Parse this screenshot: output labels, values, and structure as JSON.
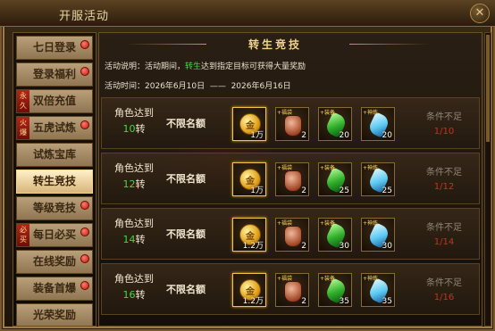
{
  "window": {
    "title": "开服活动",
    "close_glyph": "✕"
  },
  "sidebar": {
    "items": [
      {
        "label": "七日登录",
        "badge": true,
        "tag": "",
        "active": false
      },
      {
        "label": "登录福利",
        "badge": true,
        "tag": "",
        "active": false
      },
      {
        "label": "双倍充值",
        "badge": false,
        "tag": "永久",
        "active": false
      },
      {
        "label": "五虎试炼",
        "badge": true,
        "tag": "火爆",
        "active": false
      },
      {
        "label": "试炼宝库",
        "badge": false,
        "tag": "",
        "active": false
      },
      {
        "label": "转生竞技",
        "badge": false,
        "tag": "",
        "active": true
      },
      {
        "label": "等级竞技",
        "badge": true,
        "tag": "",
        "active": false
      },
      {
        "label": "每日必买",
        "badge": true,
        "tag": "必买",
        "active": false
      },
      {
        "label": "在线奖励",
        "badge": true,
        "tag": "",
        "active": false
      },
      {
        "label": "装备首爆",
        "badge": true,
        "tag": "",
        "active": false
      },
      {
        "label": "光荣奖励",
        "badge": false,
        "tag": "",
        "active": false
      }
    ]
  },
  "panel": {
    "banner": "转生竞技",
    "desc_prefix": "活动说明：活动期间，",
    "desc_highlight": "转生",
    "desc_suffix": "达到指定目标可获得大量奖励",
    "time_label": "活动时间：",
    "time_start": "2026年6月10日",
    "time_sep": "——",
    "time_end": "2026年6月16日"
  },
  "rows": [
    {
      "req_line1": "角色达到",
      "req_level": "10",
      "req_unit": "转",
      "quota": "不限名额",
      "rewards": [
        {
          "icon": "gold-coin-icon",
          "count": "1万",
          "ribbon": ""
        },
        {
          "icon": "lucky-bag-icon",
          "count": "2",
          "ribbon": "+福袋"
        },
        {
          "icon": "green-gem-icon",
          "count": "20",
          "ribbon": "+装备"
        },
        {
          "icon": "blue-crystal-icon",
          "count": "20",
          "ribbon": "+神炼"
        }
      ],
      "status": "条件不足",
      "progress": "1/10"
    },
    {
      "req_line1": "角色达到",
      "req_level": "12",
      "req_unit": "转",
      "quota": "不限名额",
      "rewards": [
        {
          "icon": "gold-coin-icon",
          "count": "1万",
          "ribbon": ""
        },
        {
          "icon": "lucky-bag-icon",
          "count": "2",
          "ribbon": "+福袋"
        },
        {
          "icon": "green-gem-icon",
          "count": "25",
          "ribbon": "+装备"
        },
        {
          "icon": "blue-crystal-icon",
          "count": "25",
          "ribbon": "+神炼"
        }
      ],
      "status": "条件不足",
      "progress": "1/12"
    },
    {
      "req_line1": "角色达到",
      "req_level": "14",
      "req_unit": "转",
      "quota": "不限名额",
      "rewards": [
        {
          "icon": "gold-coin-icon",
          "count": "1.2万",
          "ribbon": ""
        },
        {
          "icon": "lucky-bag-icon",
          "count": "2",
          "ribbon": "+福袋"
        },
        {
          "icon": "green-gem-icon",
          "count": "30",
          "ribbon": "+装备"
        },
        {
          "icon": "blue-crystal-icon",
          "count": "30",
          "ribbon": "+神炼"
        }
      ],
      "status": "条件不足",
      "progress": "1/14"
    },
    {
      "req_line1": "角色达到",
      "req_level": "16",
      "req_unit": "转",
      "quota": "不限名额",
      "rewards": [
        {
          "icon": "gold-coin-icon",
          "count": "1.2万",
          "ribbon": ""
        },
        {
          "icon": "lucky-bag-icon",
          "count": "2",
          "ribbon": "+福袋"
        },
        {
          "icon": "green-gem-icon",
          "count": "35",
          "ribbon": "+装备"
        },
        {
          "icon": "blue-crystal-icon",
          "count": "35",
          "ribbon": "+神炼"
        }
      ],
      "status": "条件不足",
      "progress": "1/16"
    }
  ]
}
